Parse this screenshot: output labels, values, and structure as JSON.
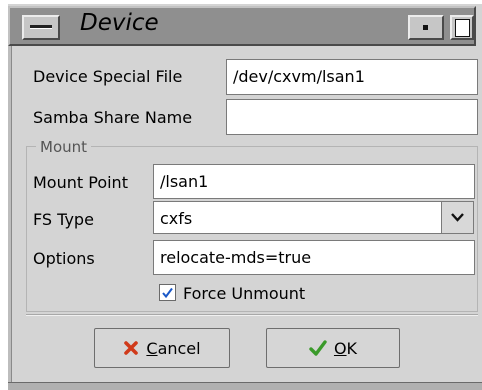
{
  "window": {
    "title": "Device"
  },
  "form": {
    "device_special_file_label": "Device Special File",
    "device_special_file_value": "/dev/cxvm/lsan1",
    "samba_share_name_label": "Samba Share Name",
    "samba_share_name_value": ""
  },
  "mount": {
    "legend": "Mount",
    "mount_point_label": "Mount Point",
    "mount_point_value": "/lsan1",
    "fs_type_label": "FS Type",
    "fs_type_value": "cxfs",
    "options_label": "Options",
    "options_value": "relocate-mds=true",
    "force_unmount_label": "Force Unmount",
    "force_unmount_checked": true
  },
  "buttons": {
    "cancel_mnemonic": "C",
    "cancel_rest": "ancel",
    "ok_mnemonic": "O",
    "ok_rest": "K"
  },
  "colors": {
    "titlebar": "#8f8f8f",
    "dialog_bg": "#d4d4d4",
    "check_blue": "#1a58c8",
    "cancel_red": "#d03a1a",
    "ok_green": "#3a9a2a"
  },
  "icons": {
    "window_menu": "window-menu-icon",
    "minimize": "minimize-icon",
    "maximize": "maximize-icon",
    "dropdown": "chevron-down-icon",
    "checkmark": "checkmark-icon",
    "cancel": "x-icon",
    "ok": "check-icon"
  }
}
